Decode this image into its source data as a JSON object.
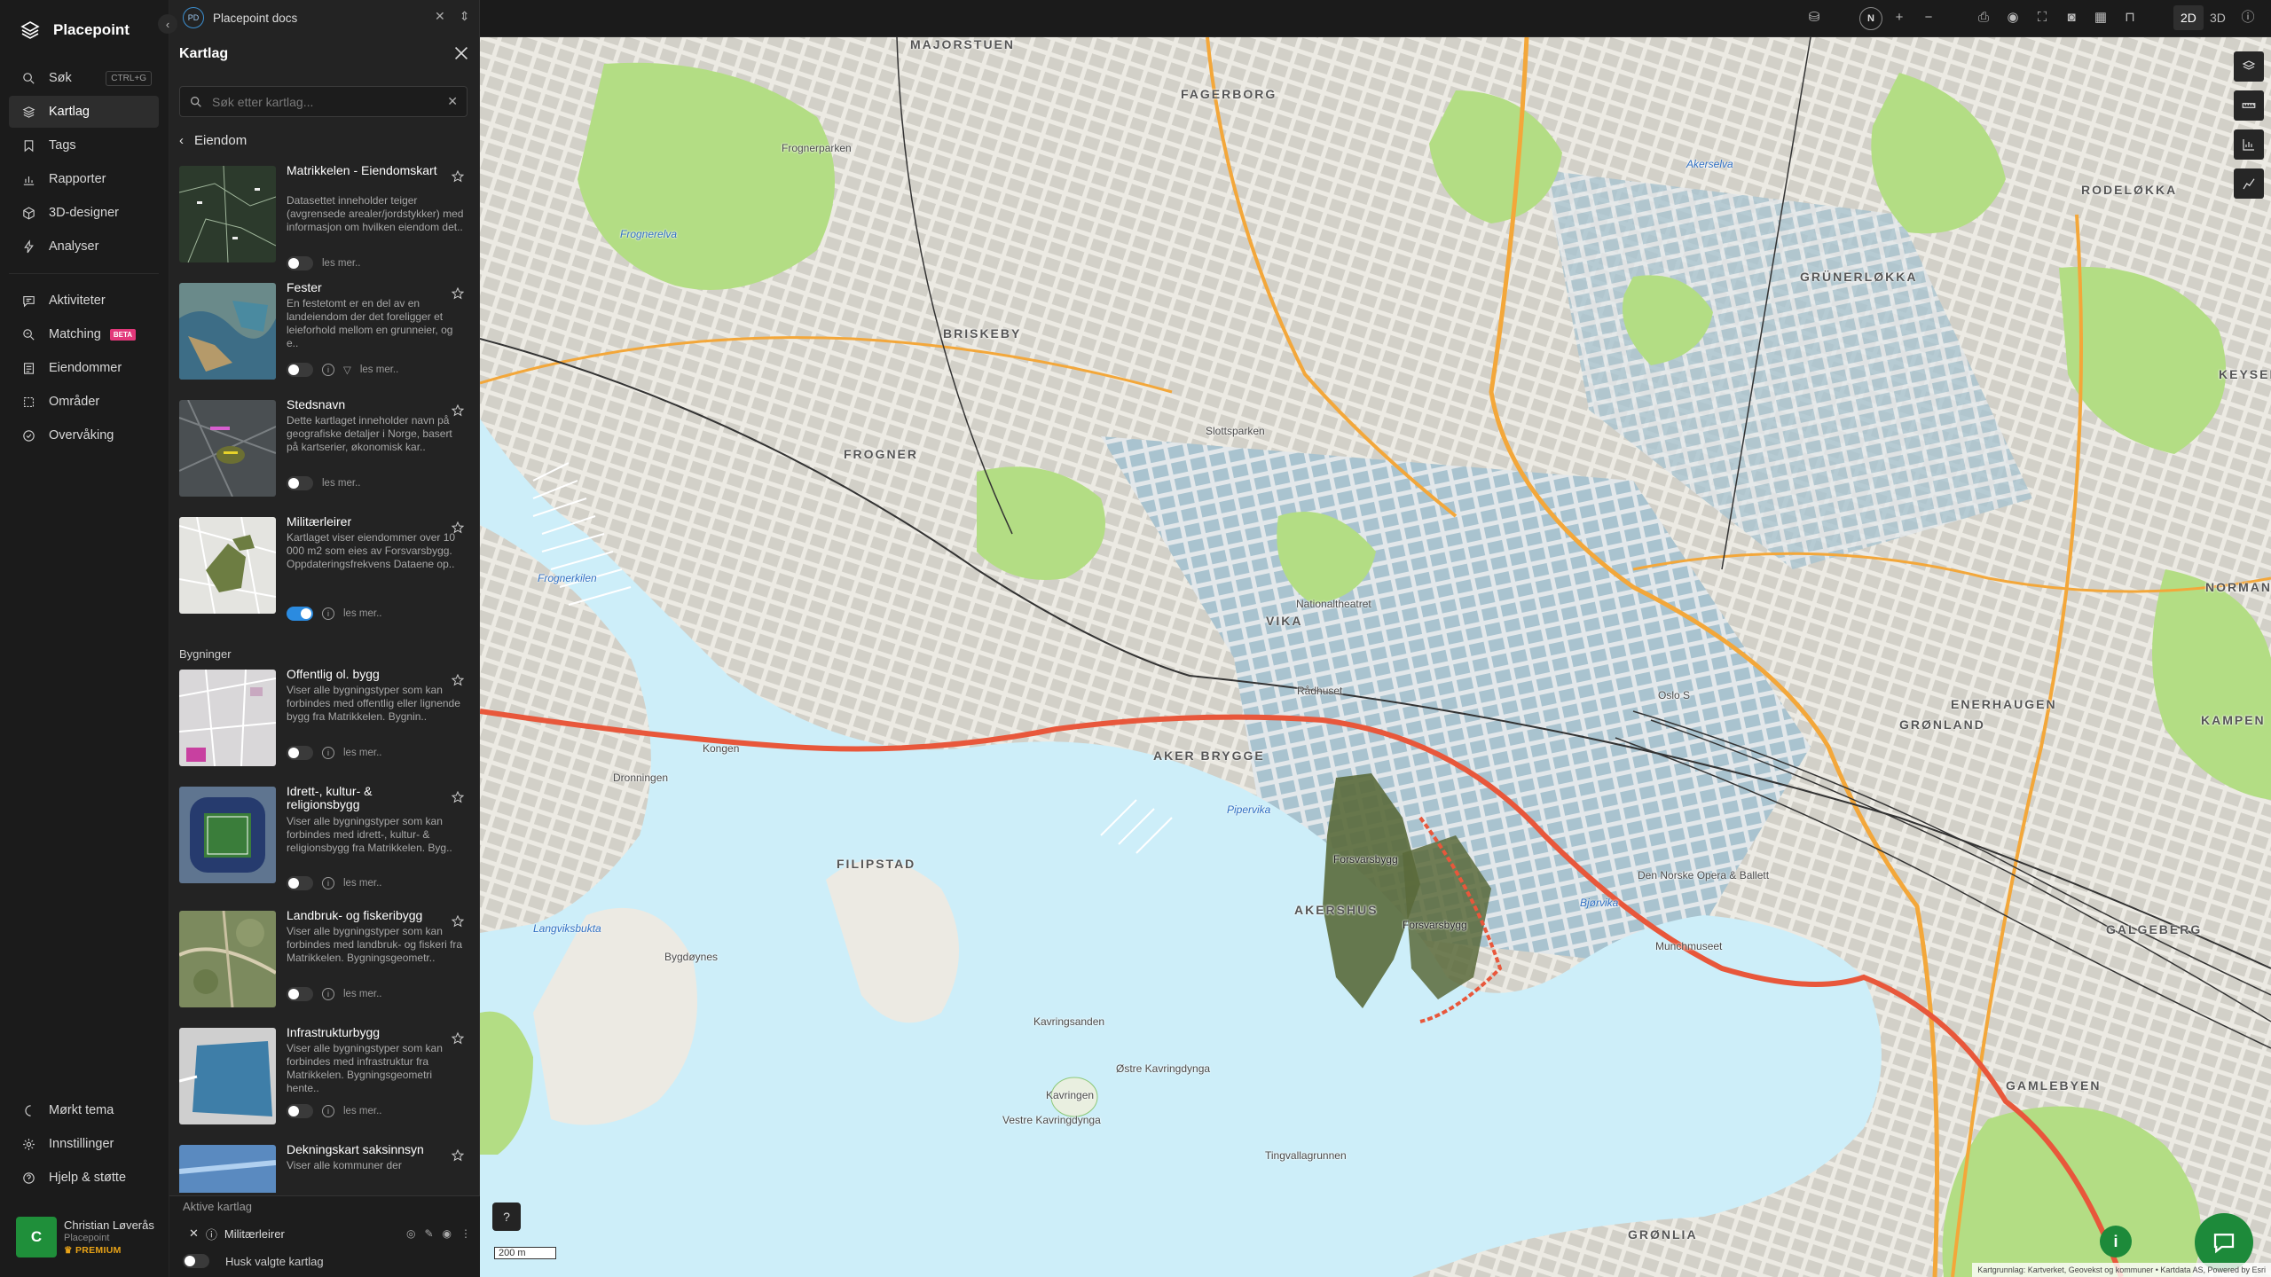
{
  "app": {
    "name": "Placepoint"
  },
  "nav": {
    "items": [
      {
        "label": "Søk",
        "shortcut": "CTRL+G"
      },
      {
        "label": "Kartlag"
      },
      {
        "label": "Tags"
      },
      {
        "label": "Rapporter"
      },
      {
        "label": "3D-designer"
      },
      {
        "label": "Analyser"
      }
    ],
    "items2": [
      {
        "label": "Aktiviteter"
      },
      {
        "label": "Matching",
        "badge": "BETA"
      },
      {
        "label": "Eiendommer"
      },
      {
        "label": "Områder"
      },
      {
        "label": "Overvåking"
      }
    ],
    "bottom": [
      {
        "label": "Mørkt tema"
      },
      {
        "label": "Innstillinger"
      },
      {
        "label": "Hjelp & støtte"
      }
    ],
    "user": {
      "initial": "C",
      "name": "Christian Løverås",
      "org": "Placepoint",
      "plan": "PREMIUM"
    }
  },
  "doc": {
    "badge": "PD",
    "title": "Placepoint docs"
  },
  "panel": {
    "title": "Kartlag",
    "search_placeholder": "Søk etter kartlag...",
    "breadcrumb": "Eiendom",
    "read_more": "les mer..",
    "layers": [
      {
        "name": "Matrikkelen - Eiendomskart",
        "desc": "Datasettet inneholder teiger (avgrensede arealer/jordstykker) med informasjon om hvilken eiendom det..",
        "on": false
      },
      {
        "name": "Fester",
        "desc": "En festetomt er en del av en landeiendom der det foreligger et leieforhold mellom en grunneier, og e..",
        "on": false
      },
      {
        "name": "Stedsnavn",
        "desc": "Dette kartlaget inneholder navn på geografiske detaljer i Norge, basert på kartserier, økonomisk kar..",
        "on": false
      },
      {
        "name": "Militærleirer",
        "desc": "Kartlaget viser eiendommer over 10 000 m2 som eies av Forsvarsbygg. Oppdateringsfrekvens Dataene op..",
        "on": true
      }
    ],
    "group2": "Bygninger",
    "layers2": [
      {
        "name": "Offentlig ol. bygg",
        "desc": "Viser alle bygningstyper som kan forbindes med offentlig eller lignende bygg fra Matrikkelen. Bygnin..",
        "on": false
      },
      {
        "name": "Idrett-, kultur- & religionsbygg",
        "desc": "Viser alle bygningstyper som kan forbindes med idrett-, kultur- & religionsbygg fra Matrikkelen. Byg..",
        "on": false
      },
      {
        "name": "Landbruk- og fiskeribygg",
        "desc": "Viser alle bygningstyper som kan forbindes med landbruk- og fiskeri fra Matrikkelen. Bygningsgeometr..",
        "on": false
      },
      {
        "name": "Infrastrukturbygg",
        "desc": "Viser alle bygningstyper som kan forbindes med infrastruktur fra Matrikkelen. Bygningsgeometri hente..",
        "on": false
      },
      {
        "name": "Dekningskart saksinnsyn",
        "desc": "Viser alle kommuner der",
        "on": false
      }
    ],
    "active_title": "Aktive kartlag",
    "active_layer": "Militærleirer",
    "remember": "Husk valgte kartlag"
  },
  "topbar": {
    "compass": "N",
    "mode_2d": "2D",
    "mode_3d": "3D"
  },
  "map": {
    "scale": "200 m",
    "attribution": "Kartgrunnlag: Kartverket, Geovekst og kommuner • Kartdata AS, Powered by Esri",
    "districts": [
      "MAJORSTUEN",
      "FAGERBORG",
      "BRISKEBY",
      "FROGNER",
      "RODELØKKA",
      "GRÜNERLØKKA",
      "KEYSERL",
      "VIKA",
      "AKER BRYGGE",
      "FILIPSTAD",
      "AKERSHUS",
      "ENERHAUGEN",
      "GRØNLAND",
      "KAMPEN",
      "GAMLEBYEN",
      "GRØNLIA",
      "NORMAN",
      "GALGEBERG"
    ],
    "places": [
      "Frognerparken",
      "Slottsparken",
      "Oslo S",
      "Rådhuset",
      "Nationaltheatret",
      "Frognerkilen",
      "Pipervika",
      "Bjørvika",
      "Akerselva",
      "Frognerelva",
      "Kavringsanden",
      "Kavringen",
      "Østre Kavringdynga",
      "Vestre Kavringdynga",
      "Tingvallagrunnen",
      "Bygdøynes",
      "Kongen",
      "Langviksbukta",
      "Dronningen",
      "Munchmuseet",
      "Den Norske Opera & Ballett",
      "Forsvarsbygg",
      "Forsvarsbygg"
    ]
  },
  "colors": {
    "brand_green": "#1d8a3a",
    "toggle_on": "#2b8be0",
    "military": "#5a6a3b",
    "water": "#cfeefa",
    "park": "#b3dd84"
  }
}
